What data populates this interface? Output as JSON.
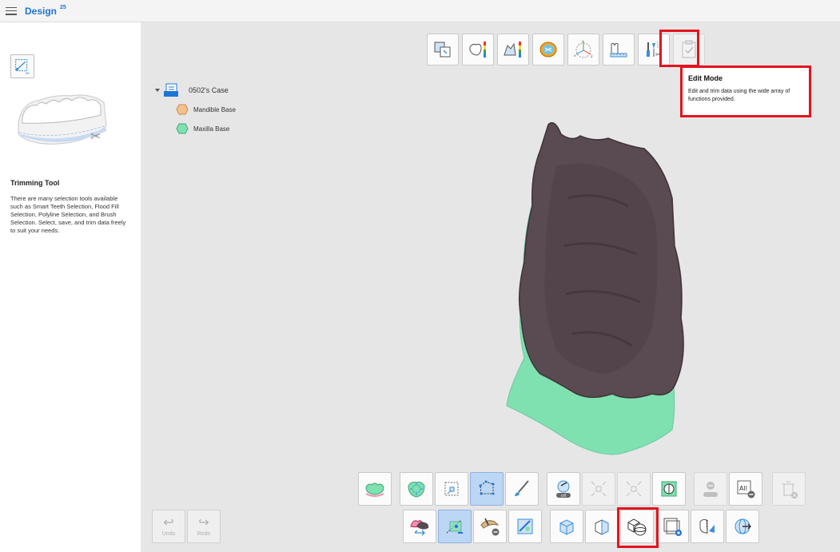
{
  "header": {
    "app_title": "Design",
    "app_badge": "25"
  },
  "left_panel": {
    "tool_title": "Trimming Tool",
    "tool_description": "There are many selection tools available such as Smart Teeth Selection, Flood Fill Selection, Polyline Selection, and Brush Selection. Select, save, and trim data freely to suit your needs."
  },
  "tooltip": {
    "title": "Edit Mode",
    "description": "Edit and trim data using the wide array of functions provided."
  },
  "tree": {
    "case_label": "0502's Case",
    "items": [
      {
        "label": "Mandible Base",
        "color": "#f5c08c"
      },
      {
        "label": "Maxilla Base",
        "color": "#7fe0b0"
      }
    ]
  },
  "top_toolbar_icons": [
    "view-align-icon",
    "tooth-heatmap-icon",
    "section-heatmap-icon",
    "occlusion-map-icon",
    "axis-icon",
    "ruler-icon",
    "edit-mode-icon",
    "checklist-icon"
  ],
  "bottom_toolbar_icons": [
    "smart-teeth-selection-icon",
    "flood-fill-selection-icon",
    "rectangle-selection-icon",
    "polyline-selection-icon",
    "brush-selection-icon",
    "selection-off-icon",
    "shrink-selection-icon",
    "expand-selection-icon",
    "invert-selection-icon",
    "deselect-off-icon",
    "deselect-all-icon",
    "delete-icon",
    "swap-data-icon",
    "select-through-icon",
    "smooth-icon",
    "fill-hole-icon",
    "cube-icon",
    "cut-plane-icon",
    "boolean-icon",
    "add-frame-icon",
    "trim-icon",
    "rotate-sphere-icon"
  ],
  "undo": {
    "label": "Undo"
  },
  "redo": {
    "label": "Redo"
  },
  "colors": {
    "accent": "#1e74d4",
    "highlight": "#e3141e",
    "maxilla": "#7fe0b0",
    "mandible_model": "#5a4a52"
  }
}
